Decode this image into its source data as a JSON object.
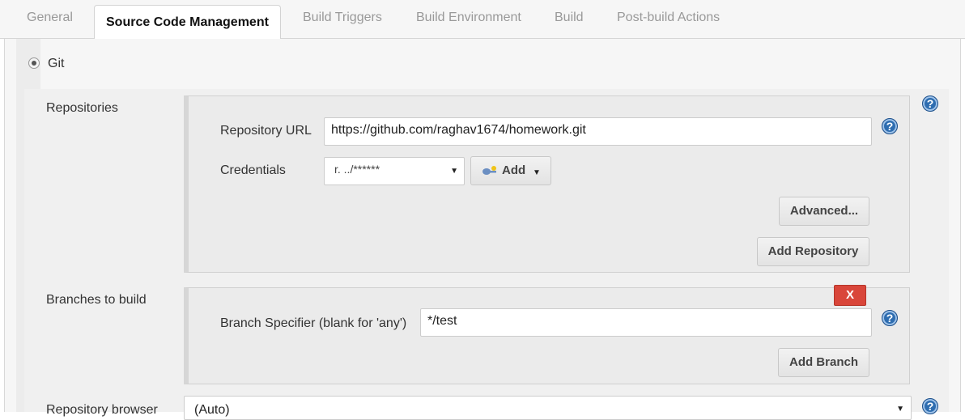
{
  "tabs": [
    {
      "label": "General",
      "active": false
    },
    {
      "label": "Source Code Management",
      "active": true
    },
    {
      "label": "Build Triggers",
      "active": false
    },
    {
      "label": "Build Environment",
      "active": false
    },
    {
      "label": "Build",
      "active": false
    },
    {
      "label": "Post-build Actions",
      "active": false
    }
  ],
  "scm": {
    "option_label": "Git",
    "selected": true
  },
  "repositories": {
    "section_label": "Repositories",
    "url_label": "Repository URL",
    "url_value": "https://github.com/raghav1674/homework.git",
    "credentials_label": "Credentials",
    "credentials_value": "r.        ../******",
    "add_label": "Add",
    "advanced_label": "Advanced...",
    "add_repository_label": "Add Repository"
  },
  "branches": {
    "section_label": "Branches to build",
    "delete_label": "X",
    "specifier_label": "Branch Specifier (blank for 'any')",
    "specifier_value": "*/test",
    "add_branch_label": "Add Branch"
  },
  "browser": {
    "section_label": "Repository browser",
    "value": "(Auto)"
  },
  "help_glyph": "?",
  "icons": {
    "help": "help-icon",
    "key": "key-icon",
    "caret": "caret-down-icon"
  },
  "colors": {
    "help_blue": "#2e6db0",
    "delete_red": "#d9463a"
  }
}
